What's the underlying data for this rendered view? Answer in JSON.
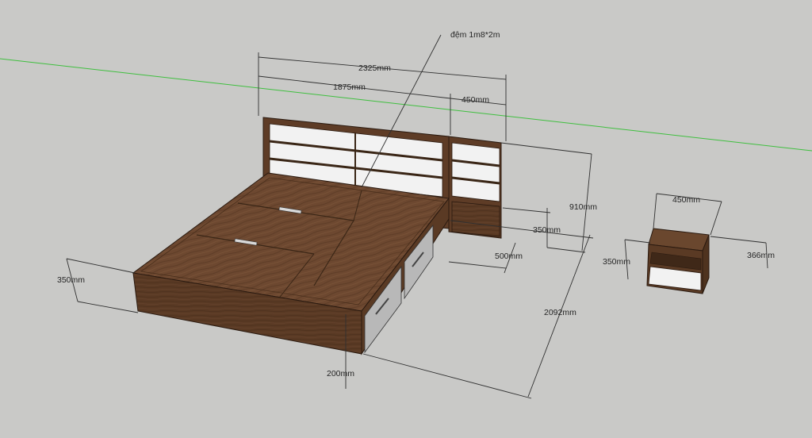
{
  "scene": {
    "background": "#c9c9c7",
    "axis_color": "#3fbf3f",
    "wood_top": "#6f4a2f",
    "wood_front": "#5a3a24",
    "panel_white": "#f2f2f2",
    "drawer_grey": "#b8b8b8"
  },
  "labels": {
    "mattress_note": "đệm 1m8*2m",
    "total_width": "2325mm",
    "bed_width": "1875mm",
    "side_panel_width": "450mm",
    "headboard_height": "910mm",
    "nightstand_offset": "350mm",
    "side_panel_depth": "500mm",
    "bed_length": "2092mm",
    "bed_height": "350mm",
    "plinth_height": "200mm",
    "nightstand_width": "450mm",
    "nightstand_height": "350mm",
    "nightstand_depth": "366mm"
  }
}
